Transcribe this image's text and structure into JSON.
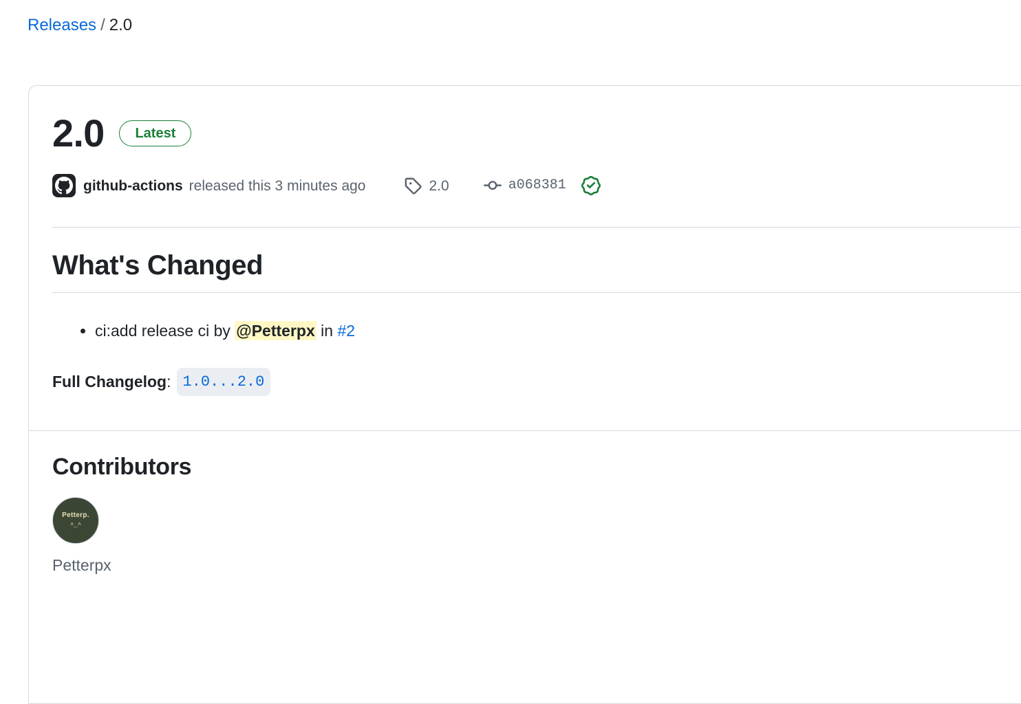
{
  "breadcrumb": {
    "parent_label": "Releases",
    "separator": "/",
    "current_label": "2.0"
  },
  "release": {
    "title": "2.0",
    "latest_badge": "Latest",
    "author": {
      "name": "github-actions",
      "avatar_icon": "github-octocat-icon"
    },
    "published_text": "released this 3 minutes ago",
    "tag": {
      "icon": "tag-icon",
      "name": "2.0"
    },
    "commit": {
      "icon": "git-commit-icon",
      "sha": "a068381"
    },
    "verified": {
      "icon": "verified-badge-icon",
      "color": "#1a7f37"
    }
  },
  "changelog": {
    "heading": "What's Changed",
    "items": [
      {
        "text_before": "ci:add release ci by ",
        "mention": "@Petterpx",
        "text_middle": " in ",
        "issue": "#2"
      }
    ],
    "full_changelog_label": "Full Changelog",
    "full_changelog_colon": ":",
    "full_changelog_compare": "1.0...2.0"
  },
  "contributors": {
    "heading": "Contributors",
    "people": [
      {
        "username": "Petterpx",
        "avatar_text": "Petterp.",
        "avatar_face": "^_^",
        "avatar_bg": "#3c4634"
      }
    ]
  },
  "colors": {
    "link": "#0969da",
    "green": "#1a7f37",
    "border": "#d1d9e0",
    "muted_text": "#59636e",
    "mention_highlight": "#fff8c5",
    "code_chip_bg": "#eaeef2"
  }
}
